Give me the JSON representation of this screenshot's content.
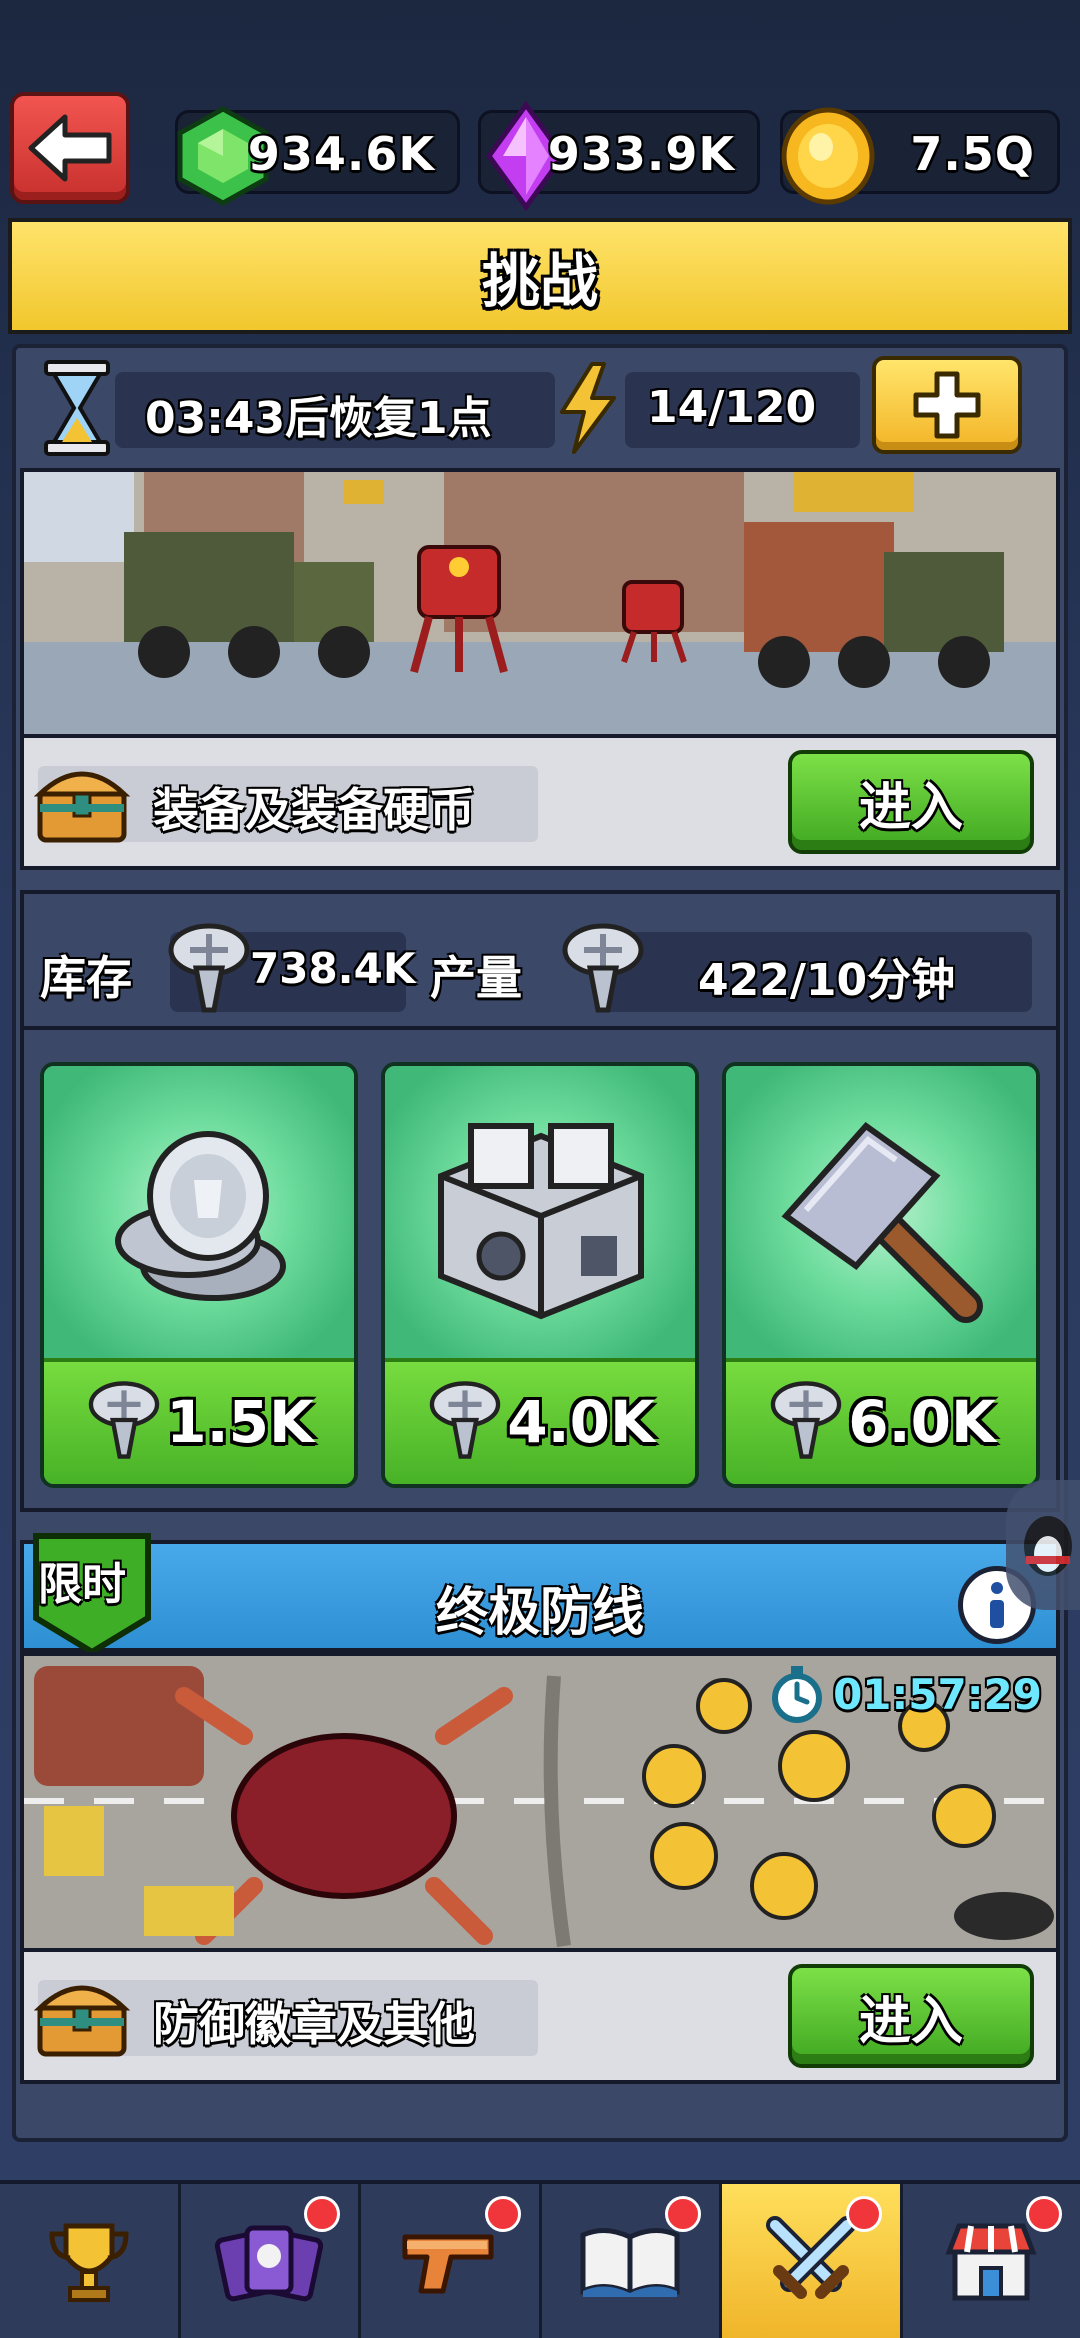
{
  "currencies": {
    "emerald": "934.6K",
    "crystal": "933.9K",
    "gold": "7.5Q"
  },
  "title": "挑战",
  "energy": {
    "timer_text": "03:43后恢复1点",
    "count": "14/120"
  },
  "challenge1": {
    "reward_label": "装备及装备硬币",
    "enter_label": "进入"
  },
  "stock": {
    "stock_label": "库存",
    "stock_value": "738.4K",
    "production_label": "产量",
    "production_value": "422/10分钟"
  },
  "shop": [
    {
      "item": "silver-coins",
      "price": "1.5K"
    },
    {
      "item": "metal-crate",
      "price": "4.0K"
    },
    {
      "item": "hammer",
      "price": "6.0K"
    }
  ],
  "limited": {
    "tag": "限时",
    "title": "终极防线",
    "countdown": "01:57:29",
    "reward_label": "防御徽章及其他",
    "enter_label": "进入"
  },
  "nav": [
    {
      "icon": "trophy-icon",
      "badge": false,
      "active": false
    },
    {
      "icon": "cards-icon",
      "badge": true,
      "active": false
    },
    {
      "icon": "pistol-icon",
      "badge": true,
      "active": false
    },
    {
      "icon": "book-icon",
      "badge": true,
      "active": false
    },
    {
      "icon": "crossed-swords-icon",
      "badge": true,
      "active": true
    },
    {
      "icon": "shop-icon",
      "badge": true,
      "active": false
    }
  ],
  "colors": {
    "accent_yellow": "#f1c72d",
    "enter_green": "#3fa721",
    "limited_blue": "#2e8fd3",
    "badge_red": "#f0353b"
  }
}
